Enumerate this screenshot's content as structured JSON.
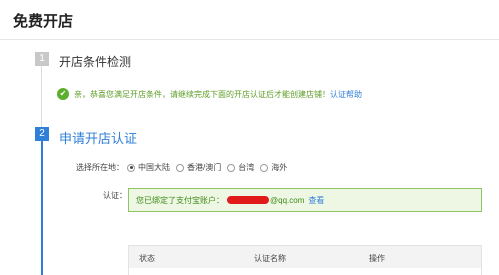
{
  "header": {
    "title": "免费开店"
  },
  "steps": [
    {
      "number": "1",
      "title": "开店条件检测",
      "notice": {
        "text": "亲，恭喜您满足开店条件，请继续完成下面的开店认证后才能创建店铺！",
        "link": "认证帮助"
      }
    },
    {
      "number": "2",
      "title": "申请开店认证",
      "location": {
        "label": "选择所在地：",
        "options": [
          "中国大陆",
          "香港/澳门",
          "台湾",
          "海外"
        ],
        "selected": "中国大陆"
      },
      "auth": {
        "label": "认证：",
        "bound_prefix": "您已绑定了支付宝账户：",
        "bound_suffix": "@qq.com",
        "view_link": "查看"
      },
      "table": {
        "columns": [
          "状态",
          "认证名称",
          "操作"
        ]
      }
    }
  ],
  "colors": {
    "accent": "#2f7fd8",
    "success": "#5cae2c",
    "redaction": "#e11a1a"
  }
}
